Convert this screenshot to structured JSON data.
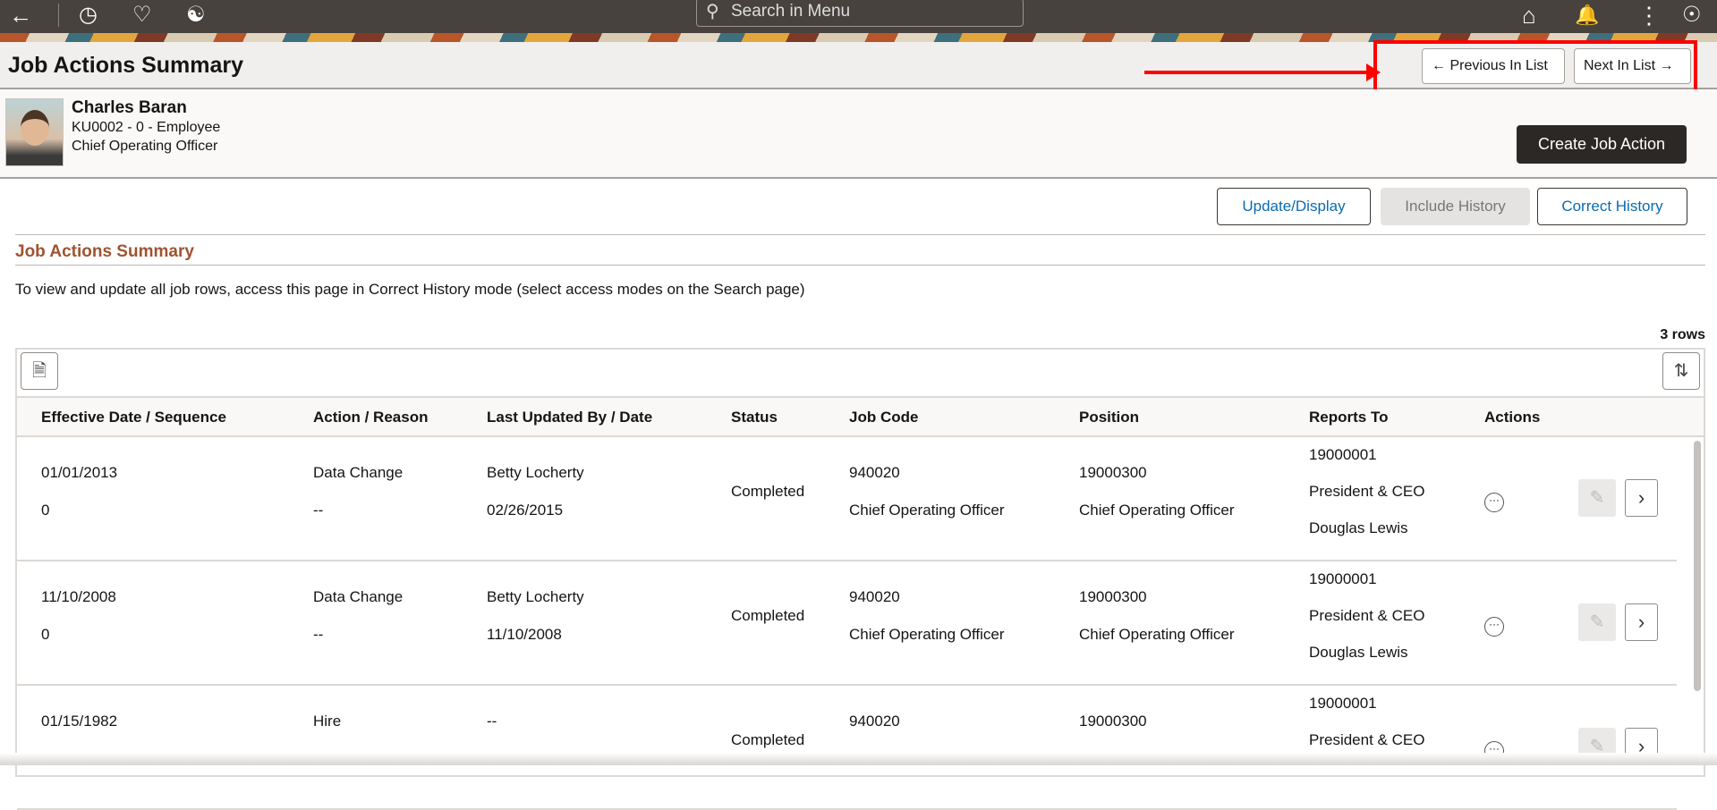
{
  "topbar": {
    "search_placeholder": "Search in Menu",
    "icons": [
      "back-arrow-icon",
      "recent-clock-icon",
      "favorites-heart-icon",
      "accessibility-icon",
      "home-icon",
      "notifications-bell-icon",
      "more-vertical-icon",
      "navigator-compass-icon"
    ]
  },
  "titlebar": {
    "title": "Job Actions Summary",
    "previous_label": "Previous In List",
    "next_label": "Next In List"
  },
  "employee": {
    "name": "Charles Baran",
    "id_line": "KU0002 - 0 - Employee",
    "job_title": "Chief Operating Officer",
    "create_label": "Create Job Action"
  },
  "modes": {
    "update": "Update/Display",
    "include": "Include History",
    "correct": "Correct History"
  },
  "section": {
    "title": "Job Actions Summary",
    "instruction": "To view and update all job rows, access this page in Correct History mode (select access modes on the Search page)",
    "row_count": "3 rows"
  },
  "columns": [
    "Effective Date / Sequence",
    "Action / Reason",
    "Last Updated By / Date",
    "Status",
    "Job Code",
    "Position",
    "Reports To",
    "Actions"
  ],
  "rows": [
    {
      "date": "01/01/2013",
      "seq": "0",
      "action": "Data Change",
      "reason": "--",
      "updated_by": "Betty Locherty",
      "updated_date": "02/26/2015",
      "status": "Completed",
      "job_code": "940020",
      "job_title": "Chief Operating Officer",
      "position": "19000300",
      "position_title": "Chief Operating Officer",
      "reports_id": "19000001",
      "reports_title": "President & CEO",
      "reports_name": "Douglas Lewis"
    },
    {
      "date": "11/10/2008",
      "seq": "0",
      "action": "Data Change",
      "reason": "--",
      "updated_by": "Betty Locherty",
      "updated_date": "11/10/2008",
      "status": "Completed",
      "job_code": "940020",
      "job_title": "Chief Operating Officer",
      "position": "19000300",
      "position_title": "Chief Operating Officer",
      "reports_id": "19000001",
      "reports_title": "President & CEO",
      "reports_name": "Douglas Lewis"
    },
    {
      "date": "01/15/1982",
      "seq": "",
      "action": "Hire",
      "reason": "",
      "updated_by": "--",
      "updated_date": "",
      "status": "Completed",
      "job_code": "940020",
      "job_title": "",
      "position": "19000300",
      "position_title": "",
      "reports_id": "19000001",
      "reports_title": "President & CEO",
      "reports_name": ""
    }
  ]
}
